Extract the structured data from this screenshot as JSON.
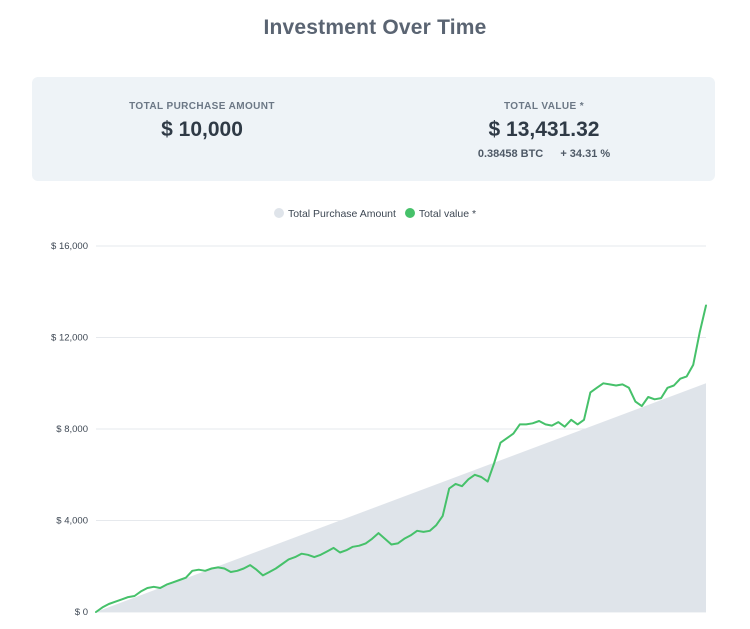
{
  "page": {
    "title": "Investment Over Time"
  },
  "summary": {
    "purchase_label": "TOTAL PURCHASE AMOUNT",
    "purchase_value": "$ 10,000",
    "value_label": "TOTAL VALUE *",
    "value_amount": "$ 13,431.32",
    "btc_amount": "0.38458 BTC",
    "percent_change": "+ 34.31 %"
  },
  "colors": {
    "purchase_area": "#dfe4ea",
    "total_line": "#46c16a",
    "grid": "#e6e9ed"
  },
  "chart_data": {
    "type": "area",
    "title": "",
    "xlabel": "",
    "ylabel": "",
    "ylim": [
      0,
      16000
    ],
    "y_ticks": [
      {
        "value": 0,
        "label": "$ 0"
      },
      {
        "value": 4000,
        "label": "$ 4,000"
      },
      {
        "value": 8000,
        "label": "$ 8,000"
      },
      {
        "value": 12000,
        "label": "$ 12,000"
      },
      {
        "value": 16000,
        "label": "$ 16,000"
      }
    ],
    "grid": true,
    "legend": "top-center",
    "series": [
      {
        "name": "Total Purchase Amount",
        "kind": "area",
        "color": "#dfe4ea",
        "values": [
          0,
          10000
        ]
      },
      {
        "name": "Total value *",
        "kind": "line",
        "color": "#46c16a",
        "values": [
          0,
          200,
          350,
          450,
          550,
          650,
          700,
          900,
          1050,
          1100,
          1050,
          1200,
          1300,
          1400,
          1500,
          1800,
          1850,
          1800,
          1900,
          1950,
          1900,
          1750,
          1800,
          1900,
          2050,
          1850,
          1600,
          1750,
          1900,
          2100,
          2300,
          2400,
          2550,
          2500,
          2400,
          2500,
          2650,
          2800,
          2600,
          2700,
          2850,
          2900,
          3000,
          3200,
          3450,
          3200,
          2950,
          3000,
          3200,
          3350,
          3550,
          3500,
          3550,
          3800,
          4200,
          5400,
          5600,
          5500,
          5800,
          6000,
          5900,
          5700,
          6500,
          7400,
          7600,
          7800,
          8200,
          8200,
          8250,
          8350,
          8200,
          8150,
          8300,
          8100,
          8400,
          8200,
          8400,
          9600,
          9800,
          10000,
          9950,
          9900,
          9950,
          9800,
          9200,
          9000,
          9400,
          9300,
          9350,
          9800,
          9900,
          10200,
          10300,
          10800,
          12200,
          13400
        ]
      }
    ]
  }
}
